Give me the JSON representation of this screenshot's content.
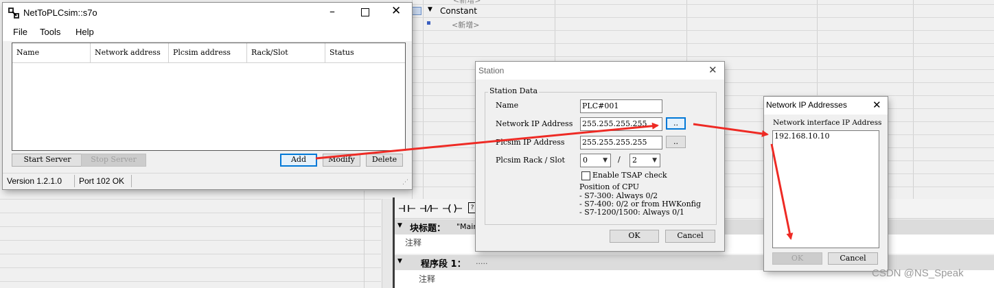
{
  "background": {
    "top_item": "<新增>",
    "constant_label": "Constant",
    "new_item": "<新增>",
    "block_title_label": "块标题：",
    "block_title_value": "\"Main",
    "comment1": "注释",
    "network_label": "程序段 1：",
    "network_dots": ".....",
    "comment2": "注释",
    "lad_icons": [
      "contact-no-icon",
      "contact-nc-icon",
      "coil-icon",
      "box-icon"
    ]
  },
  "nettoplc": {
    "title": "NetToPLCsim::s7o",
    "menu": [
      "File",
      "Tools",
      "Help"
    ],
    "columns": [
      "Name",
      "Network address",
      "Plcsim address",
      "Rack/Slot",
      "Status"
    ],
    "buttons": {
      "start": "Start Server",
      "stop": "Stop Server",
      "add": "Add",
      "modify": "Modify",
      "delete": "Delete"
    },
    "status_version": "Version 1.2.1.0",
    "status_port": "Port 102 OK"
  },
  "station": {
    "title": "Station",
    "group_label": "Station Data",
    "name_label": "Name",
    "name_value": "PLC#001",
    "net_ip_label": "Network IP Address",
    "net_ip_value": "255.255.255.255",
    "plcsim_ip_label": "Plcsim IP Address",
    "plcsim_ip_value": "255.255.255.255",
    "browse_label": "..",
    "rack_slot_label": "Plcsim Rack / Slot",
    "rack_value": "0",
    "slot_sep": "/",
    "slot_value": "2",
    "tsap_label": "Enable TSAP check",
    "tsap_checked": false,
    "cpu_position_title": "Position of CPU",
    "cpu_position_lines": [
      "- S7-300: Always 0/2",
      "- S7-400: 0/2 or from HWKonfig",
      "- S7-1200/1500: Always 0/1"
    ],
    "ok": "OK",
    "cancel": "Cancel"
  },
  "netip": {
    "title": "Network IP Addresses",
    "list_label": "Network interface IP Address",
    "items": [
      "192.168.10.10"
    ],
    "ok": "OK",
    "cancel": "Cancel"
  },
  "watermark": "CSDN @NS_Speak",
  "colors": {
    "arrow": "#ee2a24",
    "focus": "#0078d7"
  }
}
